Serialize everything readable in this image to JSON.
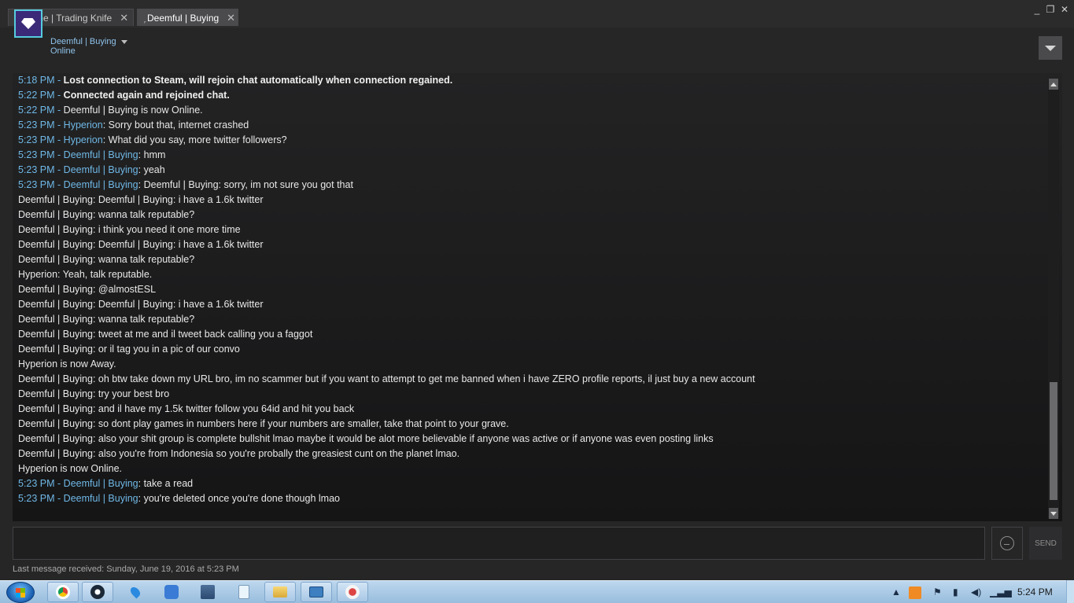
{
  "tabs": [
    {
      "label": "Xtreme | Trading Knife",
      "active": false
    },
    {
      "label": "Deemful | Buying",
      "active": true
    }
  ],
  "window_controls": {
    "minimize": "_",
    "restore": "❐",
    "close": "✕"
  },
  "header": {
    "friend_name": "Deemful | Buying",
    "status": "Online"
  },
  "messages": [
    {
      "ts": "5:18 PM - ",
      "sender": "",
      "text": "Lost connection to Steam, will rejoin chat automatically when connection regained.",
      "bold": true
    },
    {
      "ts": "5:22 PM - ",
      "sender": "",
      "text": "Connected again and rejoined chat.",
      "bold": true
    },
    {
      "ts": "5:22 PM - ",
      "sender": "",
      "text": "Deemful | Buying is now Online.",
      "bold": false
    },
    {
      "ts": "5:23 PM - ",
      "sender": "Hyperion",
      "text": ": Sorry bout that, internet crashed",
      "bold": false
    },
    {
      "ts": "5:23 PM - ",
      "sender": "Hyperion",
      "text": ": What did you say, more twitter followers?",
      "bold": false
    },
    {
      "ts": "5:23 PM - ",
      "sender": "Deemful | Buying",
      "text": ": hmm",
      "bold": false
    },
    {
      "ts": "5:23 PM - ",
      "sender": "Deemful | Buying",
      "text": ": yeah",
      "bold": false
    },
    {
      "ts": "5:23 PM - ",
      "sender": "Deemful | Buying",
      "text": ": Deemful | Buying: sorry, im not sure you got that",
      "bold": false
    },
    {
      "ts": "",
      "sender": "",
      "text": "Deemful | Buying: Deemful | Buying: i have a 1.6k twitter",
      "bold": false
    },
    {
      "ts": "",
      "sender": "",
      "text": "Deemful | Buying: wanna talk reputable?",
      "bold": false
    },
    {
      "ts": "",
      "sender": "",
      "text": "Deemful | Buying: i think you need it one more time",
      "bold": false
    },
    {
      "ts": "",
      "sender": "",
      "text": "Deemful | Buying: Deemful | Buying: i have a 1.6k twitter",
      "bold": false
    },
    {
      "ts": "",
      "sender": "",
      "text": "Deemful | Buying: wanna talk reputable?",
      "bold": false
    },
    {
      "ts": "",
      "sender": "",
      "text": "Hyperion: Yeah, talk reputable.",
      "bold": false
    },
    {
      "ts": "",
      "sender": "",
      "text": "Deemful | Buying: @almostESL",
      "bold": false
    },
    {
      "ts": "",
      "sender": "",
      "text": "Deemful | Buying: Deemful | Buying: i have a 1.6k twitter",
      "bold": false
    },
    {
      "ts": "",
      "sender": "",
      "text": "Deemful | Buying: wanna talk reputable?",
      "bold": false
    },
    {
      "ts": "",
      "sender": "",
      "text": "Deemful | Buying: tweet at me and il tweet back calling you a faggot",
      "bold": false
    },
    {
      "ts": "",
      "sender": "",
      "text": "Deemful | Buying: or il tag you in a pic of our convo",
      "bold": false
    },
    {
      "ts": "",
      "sender": "",
      "text": "Hyperion is now Away.",
      "bold": false
    },
    {
      "ts": "",
      "sender": "",
      "text": "Deemful | Buying: oh btw take down my URL bro, im no scammer but if you want to attempt to get me banned when i have ZERO profile reports, il just buy a new account",
      "bold": false
    },
    {
      "ts": "",
      "sender": "",
      "text": "Deemful | Buying: try your best bro",
      "bold": false
    },
    {
      "ts": "",
      "sender": "",
      "text": "Deemful | Buying: and il have my 1.5k twitter follow you 64id and hit you back",
      "bold": false
    },
    {
      "ts": "",
      "sender": "",
      "text": "Deemful | Buying: so dont play games in numbers here if your numbers are smaller, take that point to your grave.",
      "bold": false
    },
    {
      "ts": "",
      "sender": "",
      "text": "Deemful | Buying: also your shit group is complete bullshit lmao maybe it would be alot more believable if anyone was active or if anyone was even posting links",
      "bold": false
    },
    {
      "ts": "",
      "sender": "",
      "text": "Deemful | Buying: also you're from Indonesia so you're probally the greasiest cunt on the planet lmao.",
      "bold": false
    },
    {
      "ts": "",
      "sender": "",
      "text": "Hyperion is now Online.",
      "bold": false
    },
    {
      "ts": "5:23 PM - ",
      "sender": "Deemful | Buying",
      "text": ": take a read",
      "bold": false
    },
    {
      "ts": "5:23 PM - ",
      "sender": "Deemful | Buying",
      "text": ": you're deleted once you're done though lmao",
      "bold": false
    }
  ],
  "input": {
    "value": "",
    "placeholder": ""
  },
  "send_label": "SEND",
  "last_received": "Last message received: Sunday, June 19, 2016 at 5:23 PM",
  "taskbar": {
    "pinned": [
      "chrome-icon",
      "steam-icon",
      "maps-icon",
      "sync-icon",
      "network-icon",
      "notepad-icon",
      "folder-icon",
      "remote-icon",
      "tool-icon"
    ],
    "clock": "5:24 PM"
  },
  "colors": {
    "link_blue": "#6fb8e6",
    "background": "#262627",
    "chat_bg": "#1b1b1c"
  }
}
